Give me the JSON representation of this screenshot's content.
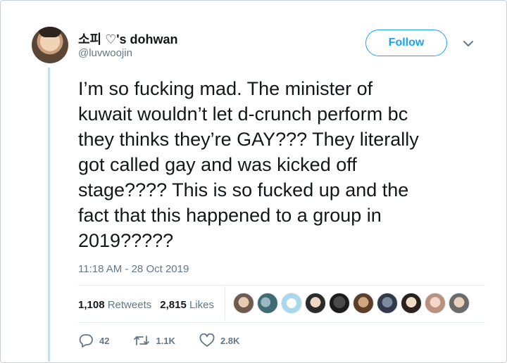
{
  "author": {
    "display_name": "소피 ♡'s dohwan",
    "username": "@luvwoojin"
  },
  "follow_button": {
    "label": "Follow"
  },
  "tweet": {
    "text": "I’m so fucking mad. The minister of\nkuwait wouldn’t let d-crunch perform bc\nthey thinks they’re GAY??? They literally\ngot called gay and was kicked off\nstage???? This is so fucked up and the\nfact that this happened to a group in\n2019?????",
    "timestamp": "11:18 AM - 28 Oct 2019"
  },
  "stats": {
    "retweets_count": "1,108",
    "retweets_label": "Retweets",
    "likes_count": "2,815",
    "likes_label": "Likes"
  },
  "actions": {
    "replies": "42",
    "retweets": "1.1K",
    "likes": "2.8K"
  },
  "colors": {
    "accent": "#1da1f2",
    "secondary_text": "#657786",
    "thread_line": "#c6dff1"
  },
  "icons": {
    "caret": "chevron-down-icon",
    "reply": "reply-icon",
    "retweet": "retweet-icon",
    "like": "heart-icon"
  }
}
